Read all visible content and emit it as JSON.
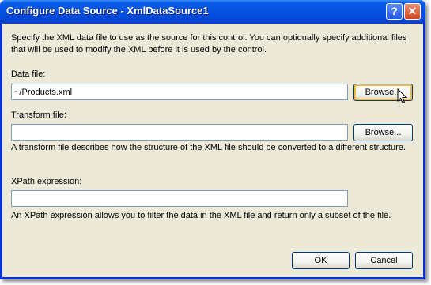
{
  "window": {
    "title": "Configure Data Source - XmlDataSource1",
    "help_icon": "help-icon",
    "close_icon": "close-icon"
  },
  "intro": "Specify the XML data file to use as the source for this control. You can optionally specify additional files that will be used to modify the XML before it is used by the control.",
  "data_file": {
    "label": "Data file:",
    "value": "~/Products.xml",
    "browse_label": "Browse..."
  },
  "transform_file": {
    "label": "Transform file:",
    "value": "",
    "browse_label": "Browse...",
    "description": "A transform file describes how the structure of the XML file should be converted to a different structure."
  },
  "xpath": {
    "label": "XPath expression:",
    "value": "",
    "description": "An XPath expression allows you to filter the data in the XML file and return only a subset of the file."
  },
  "buttons": {
    "ok": "OK",
    "cancel": "Cancel"
  }
}
